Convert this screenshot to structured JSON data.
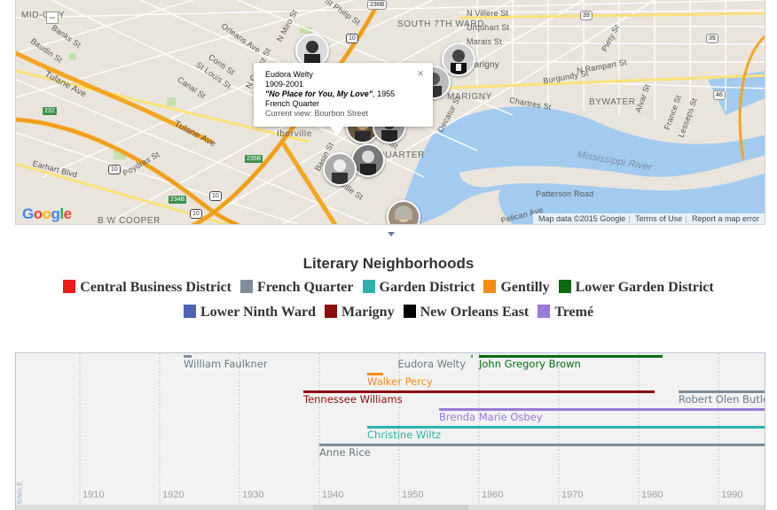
{
  "map": {
    "zoom_out": "−",
    "google_logo": "Google",
    "attribution": {
      "data": "Map data ©2015 Google",
      "terms": "Terms of Use",
      "report": "Report a map error"
    },
    "streets": [
      "MID-CITY",
      "Banks St",
      "Baudin St",
      "Tulane Ave",
      "Orleans Ave",
      "N Galvez St",
      "N Miro St",
      "St Philip St",
      "SOUTH 7TH WARD",
      "N Villere St",
      "Urquhart St",
      "Marais St",
      "N Rampart St",
      "Burgundy St",
      "Piety St",
      "Conti St",
      "St Louis St",
      "Canal St",
      "Tulane Ave",
      "Iberville",
      "Poydras St",
      "Earhart Blvd",
      "Basin St",
      "Iberville St",
      "St Ann St",
      "Decatur St",
      "MARIGNY",
      "Chartres St",
      "BYWATER",
      "Alvar St",
      "France St",
      "Lesseps St",
      "Mississippi River",
      "Patterson Road",
      "Pelican Ave",
      "QUARTER",
      "B W COOPER",
      "Marigny",
      "Carondelet St"
    ],
    "shields": [
      "236B",
      "10",
      "39",
      "39",
      "46",
      "10",
      "232",
      "235B",
      "10",
      "234B",
      "10"
    ],
    "popup": {
      "name": "Eudora Welty",
      "years": "1909-2001",
      "work": "\"No Place for You, My Love\"",
      "work_year": ", 1955",
      "place": "French Quarter",
      "current_view": "Current view: Bourbon Street",
      "close": "×"
    }
  },
  "legend": {
    "title": "Literary Neighborhoods",
    "row1": [
      {
        "label": "Central Business District",
        "color": "#ee1a1a"
      },
      {
        "label": "French Quarter",
        "color": "#7f8c99"
      },
      {
        "label": "Garden District",
        "color": "#2bb3ab"
      },
      {
        "label": "Gentilly",
        "color": "#f58b13"
      },
      {
        "label": "Lower Garden District",
        "color": "#0a6b10"
      }
    ],
    "row2": [
      {
        "label": "Lower Ninth Ward",
        "color": "#4f63b5"
      },
      {
        "label": "Marigny",
        "color": "#8b0d0d"
      },
      {
        "label": "New Orleans East",
        "color": "#000000"
      },
      {
        "label": "Tremé",
        "color": "#9a79d8"
      }
    ]
  },
  "timeline": {
    "brand": "SIMILE",
    "axis": {
      "labels": [
        "1910",
        "1920",
        "1930",
        "1940",
        "1950",
        "1960",
        "1970",
        "1980",
        "1990"
      ],
      "range": [
        1902,
        1996
      ]
    },
    "events": [
      {
        "label": "William Faulkner",
        "start": 1923,
        "end": 1924,
        "color": "#7f8c99",
        "label_color": "#6c7886",
        "row": 0,
        "label_side": "right"
      },
      {
        "label": "Eudora Welty",
        "start": 1959,
        "end": 1959,
        "color": "#7f8c99",
        "label_color": "#6c7886",
        "row": 0,
        "label_side": "left-of-end"
      },
      {
        "label": "John Gregory Brown",
        "start": 1960,
        "end": 1983,
        "color": "#0a6b10",
        "label_color": "#0a6b10",
        "row": 0,
        "label_side": "below"
      },
      {
        "label": "Walker Percy",
        "start": 1946,
        "end": 1948,
        "color": "#f58b13",
        "label_color": "#f58b13",
        "row": 1,
        "label_side": "below"
      },
      {
        "label": "Tennessee Williams",
        "start": 1938,
        "end": 1982,
        "color": "#8b0d0d",
        "label_color": "#8b0d0d",
        "row": 2,
        "label_side": "below"
      },
      {
        "label": "Robert Olen Butler",
        "start": 1985,
        "end": 1996,
        "color": "#7f8c99",
        "label_color": "#6c7886",
        "row": 2,
        "label_side": "below"
      },
      {
        "label": "Brenda Marie Osbey",
        "start": 1955,
        "end": 1996,
        "color": "#9a79d8",
        "label_color": "#9a79d8",
        "row": 3,
        "label_side": "below"
      },
      {
        "label": "Christine Wiltz",
        "start": 1946,
        "end": 1996,
        "color": "#2bb3ab",
        "label_color": "#2bb3ab",
        "row": 4,
        "label_side": "below"
      },
      {
        "label": "Anne Rice",
        "start": 1940,
        "end": 1996,
        "color": "#7f8c99",
        "label_color": "#6c7886",
        "row": 5,
        "label_side": "below"
      }
    ]
  }
}
